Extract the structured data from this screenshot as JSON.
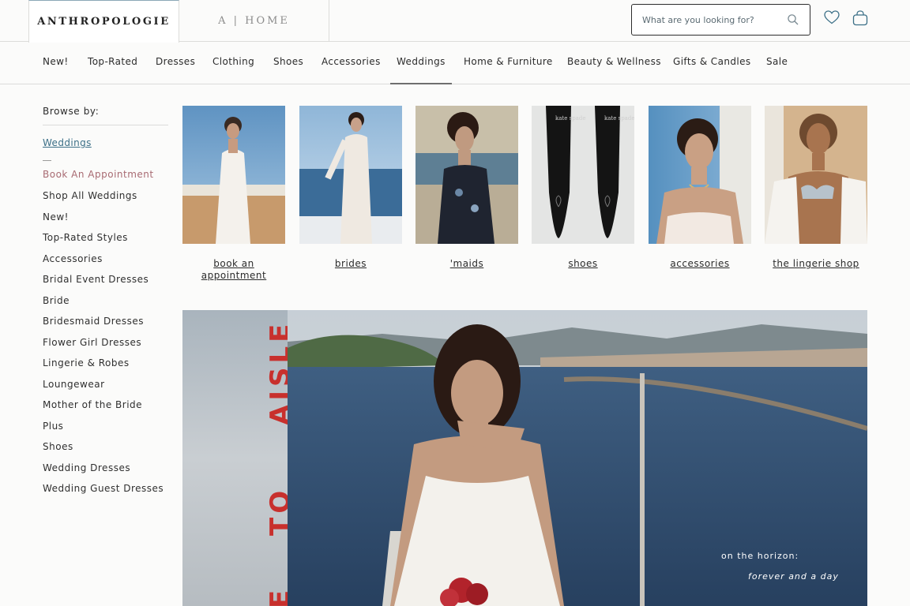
{
  "brands": {
    "main": "ANTHROPOLOGIE",
    "home": "A | HOME"
  },
  "search": {
    "placeholder": "What are you looking for?"
  },
  "icons": {
    "search": "search-icon",
    "wishlist": "heart-icon",
    "bag": "shopping-bag-icon"
  },
  "nav": {
    "items": [
      {
        "label": "New!"
      },
      {
        "label": "Top-Rated"
      },
      {
        "label": "Dresses"
      },
      {
        "label": "Clothing"
      },
      {
        "label": "Shoes"
      },
      {
        "label": "Accessories"
      },
      {
        "label": "Weddings"
      },
      {
        "label": "Home & Furniture"
      },
      {
        "label": "Beauty & Wellness"
      },
      {
        "label": "Gifts & Candles"
      },
      {
        "label": "Sale"
      }
    ],
    "active": "Weddings"
  },
  "sidebar": {
    "browse_label": "Browse by:",
    "current": "Weddings",
    "links": [
      {
        "label": "Book An Appointment"
      },
      {
        "label": "Shop All Weddings"
      },
      {
        "label": "New!"
      },
      {
        "label": "Top-Rated Styles"
      },
      {
        "label": "Accessories"
      },
      {
        "label": "Bridal Event Dresses"
      },
      {
        "label": "Bride"
      },
      {
        "label": "Bridesmaid Dresses"
      },
      {
        "label": "Flower Girl Dresses"
      },
      {
        "label": "Lingerie & Robes"
      },
      {
        "label": "Loungewear"
      },
      {
        "label": "Mother of the Bride"
      },
      {
        "label": "Plus"
      },
      {
        "label": "Shoes"
      },
      {
        "label": "Wedding Dresses"
      },
      {
        "label": "Wedding Guest Dresses"
      }
    ]
  },
  "tiles": [
    {
      "caption": "book an appointment"
    },
    {
      "caption": "brides"
    },
    {
      "caption": "'maids"
    },
    {
      "caption": "shoes",
      "shoe_brand": "kate spade"
    },
    {
      "caption": "accessories"
    },
    {
      "caption": "the lingerie shop"
    }
  ],
  "hero": {
    "vertical_text_1": "AISLE",
    "vertical_text_2": "TO",
    "vertical_text_3": "E",
    "line1": "on the horizon:",
    "line2": "forever and a day"
  },
  "colors": {
    "accent_link": "#3b6f87",
    "appointment_link": "#a86a72",
    "hero_red": "#c8302d"
  }
}
